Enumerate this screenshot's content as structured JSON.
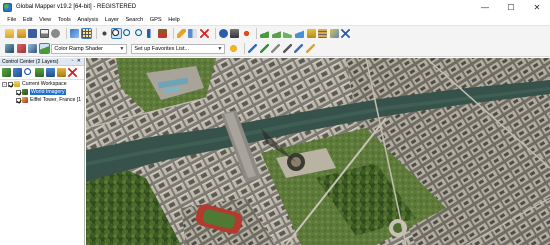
{
  "window": {
    "title": "Global Mapper v19.2 [64-bit] - REGISTERED",
    "minimize": "—",
    "maximize": "☐",
    "close": "✕"
  },
  "menu": [
    "File",
    "Edit",
    "View",
    "Tools",
    "Analysis",
    "Layer",
    "Search",
    "GPS",
    "Help"
  ],
  "toolbar2": {
    "shader": "Color Ramp Shader",
    "favorites": "Set up Favorites List..."
  },
  "control_center": {
    "title": "Control Center (2 Layers)",
    "workspace": "Current Workspace",
    "layers": [
      {
        "label": "World Imagery",
        "selected": true
      },
      {
        "label": "Eiffel Tower, France [1"
      }
    ]
  },
  "icons": {
    "toolbar1": [
      "open-folder-icon",
      "open-data-icon",
      "save-icon",
      "print-icon",
      "configure-icon",
      "control-center-icon",
      "grid-icon",
      "pan-icon",
      "zoom-icon",
      "zoom-in-icon",
      "zoom-out-icon",
      "back-icon",
      "home-icon",
      "draw-pencil-icon",
      "measure-icon",
      "delete-feature-icon",
      "info-icon",
      "digitizer-icon",
      "path-profile-icon",
      "view-shed-icon",
      "terrain-icon",
      "contour-icon",
      "watershed-icon",
      "volume-icon",
      "layer-export-icon",
      "tool-extra-icon"
    ],
    "toolbar2": [
      "elevation-legend-icon",
      "favorites-star-icon",
      "pipeline-icon",
      "feature-edit-icon",
      "align-icon",
      "brush-icon"
    ]
  }
}
